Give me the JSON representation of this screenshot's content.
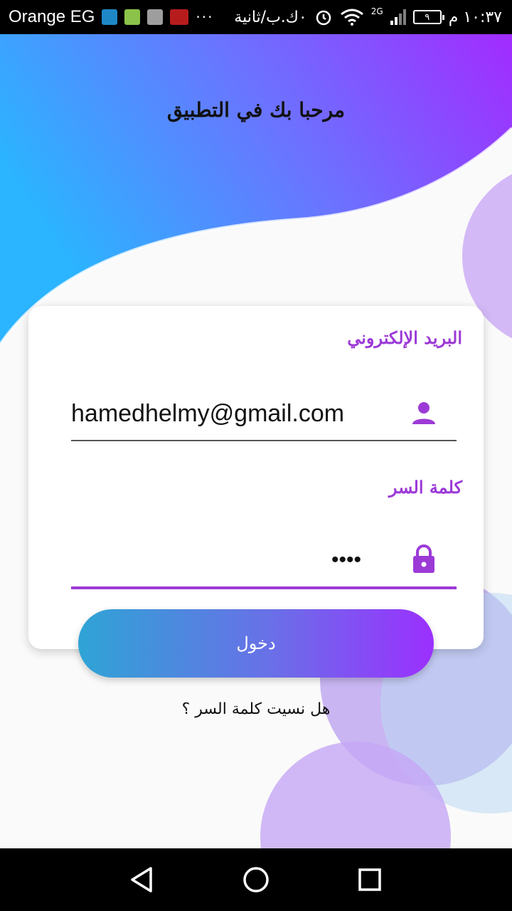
{
  "status_bar": {
    "carrier": "Orange EG",
    "more": "···",
    "data_usage": "٠ك.ب/ثانية",
    "network_type": "2G",
    "battery_level": "٩",
    "time": "١٠:٣٧ م"
  },
  "header": {
    "title": "مرحبا بك في التطبيق"
  },
  "login_form": {
    "email_label": "البريد الإلكتروني",
    "email_value": "hamedhelmy@gmail.com",
    "password_label": "كلمة السر",
    "password_value": "••••",
    "login_button": "دخول",
    "forgot_password": "هل نسيت كلمة السر ؟"
  },
  "colors": {
    "gradient_start": "#2bb4ff",
    "gradient_end": "#a22bff",
    "accent": "#9c3ad6",
    "circle_purple": "#c9a6f7",
    "circle_blue": "#b8d4f2"
  },
  "icons": {
    "email_field_icon": "person-icon",
    "password_field_icon": "lock-icon",
    "nav_back": "back-triangle-icon",
    "nav_home": "home-circle-icon",
    "nav_recent": "recent-square-icon"
  }
}
